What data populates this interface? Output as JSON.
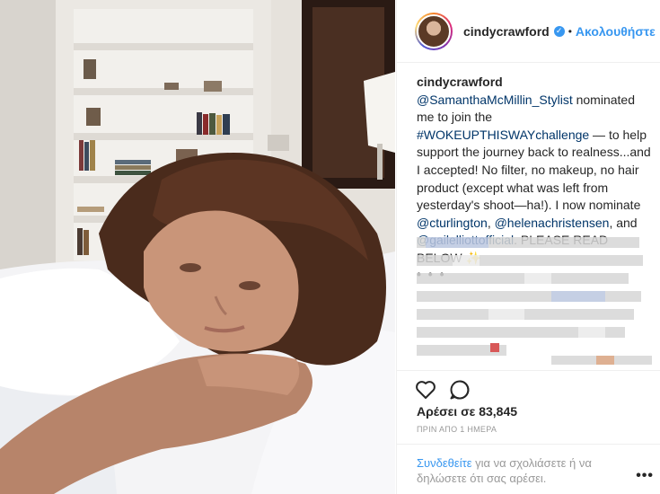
{
  "post": {
    "username": "cindycrawford",
    "follow_separator": "•",
    "follow_label": "Ακολουθήστε"
  },
  "caption": {
    "username": "cindycrawford",
    "mention_stylist": "@SamanthaMcMillin_Stylist",
    "text_1": " nominated me to join the ",
    "hashtag": "#WOKEUPTHISWAYchallenge",
    "text_2": " — to help support the journey back to realness...and I accepted! No filter, no makeup, no hair product (except what was left from yesterday's shoot—ha!). I now nominate ",
    "mention_1": "@cturlington",
    "sep_1": ", ",
    "mention_2": "@helenachristensen",
    "sep_2": ", and ",
    "mention_3": "@gailelliottofficial",
    "text_3": ". PLEASE READ BELOW ",
    "emoji": "✨",
    "more": "• • •"
  },
  "engagement": {
    "likes_label": "Αρέσει σε 83,845",
    "timestamp": "ΠΡΙΝ ΑΠΟ 1 ΗΜΕΡΑ"
  },
  "footer": {
    "login_link": "Συνδεθείτε",
    "login_text": " για να σχολιάσετε ή να δηλώσετε ότι σας αρέσει.",
    "menu": "•••"
  },
  "icons": {
    "like": "heart-icon",
    "comment": "comment-icon",
    "verified": "verified-badge-icon"
  },
  "colors": {
    "link_blue": "#3897f0",
    "mention_navy": "#003569",
    "meta_grey": "#999999"
  }
}
